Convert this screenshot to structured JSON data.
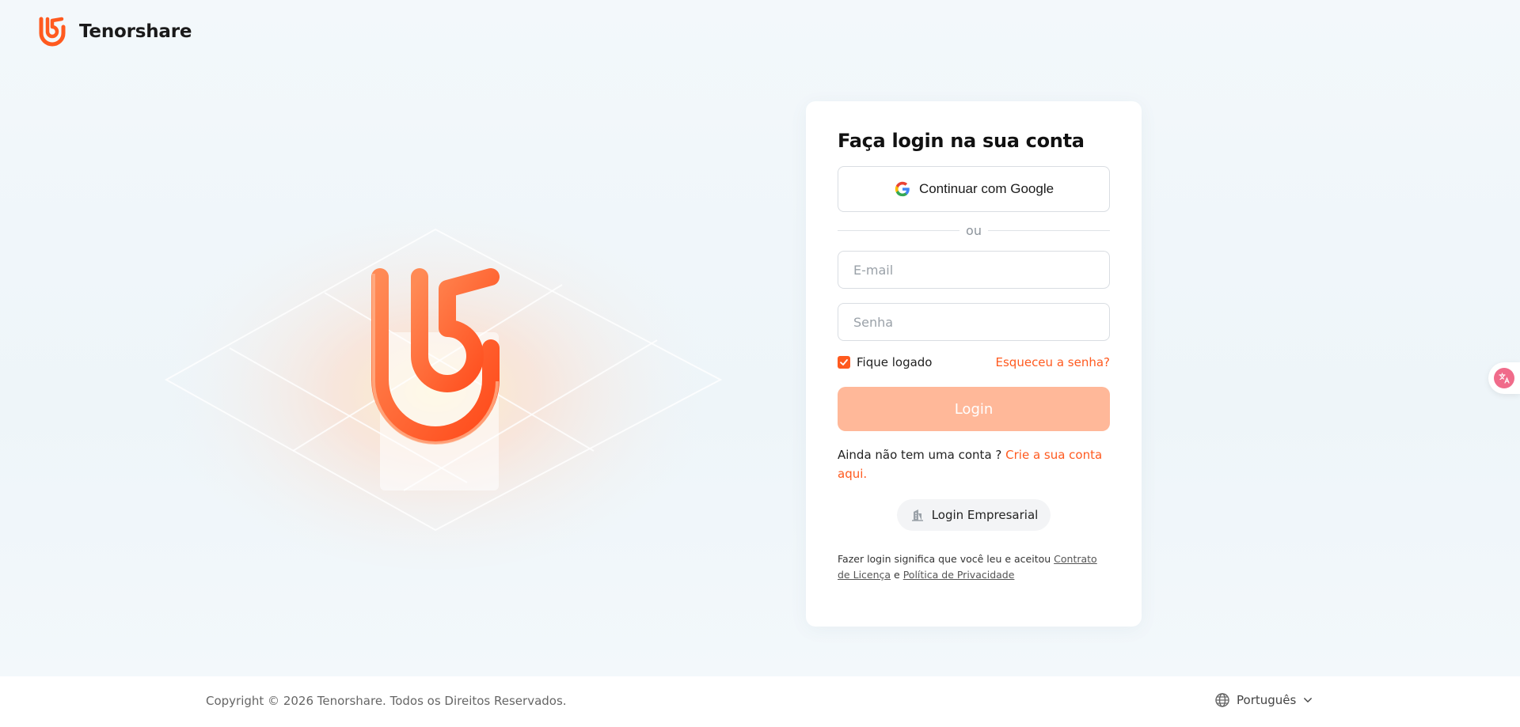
{
  "brand": {
    "name": "Tenorshare",
    "accent": "#ff5a1f"
  },
  "card": {
    "title": "Faça login na sua conta",
    "google_label": "Continuar com Google",
    "divider": "ou",
    "email_placeholder": "E-mail",
    "password_placeholder": "Senha",
    "remember_label": "Fique logado",
    "remember_checked": true,
    "forgot_label": "Esqueceu a senha?",
    "login_label": "Login",
    "signup_prefix": "Ainda não tem uma conta ? ",
    "signup_link": "Crie a sua conta aqui.",
    "enterprise_label": "Login Empresarial",
    "terms_prefix": "Fazer login significa que você leu e aceitou ",
    "terms_license": "Contrato de Licença",
    "terms_and": " e ",
    "terms_privacy": "Política de Privacidade"
  },
  "footer": {
    "copyright": "Copyright © 2026 Tenorshare. Todos os Direitos Reservados.",
    "language": "Português"
  },
  "icons": {
    "brand": "tenorshare-logo-icon",
    "google": "google-icon",
    "checkbox": "check-icon",
    "enterprise": "building-icon",
    "language": "globe-icon",
    "dropdown": "chevron-down-icon",
    "translate": "translate-icon"
  }
}
